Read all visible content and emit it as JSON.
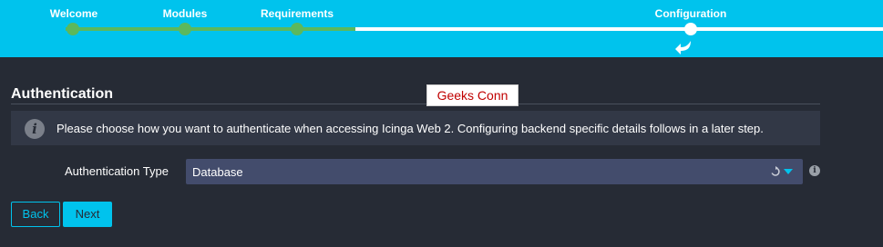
{
  "wizard": {
    "steps": [
      {
        "label": "Welcome",
        "state": "done"
      },
      {
        "label": "Modules",
        "state": "done"
      },
      {
        "label": "Requirements",
        "state": "done"
      },
      {
        "label": "Configuration",
        "state": "current"
      }
    ],
    "back_icon": "return-arrow-icon",
    "colors": {
      "header": "#00c3ed",
      "done": "#5cb85c",
      "todo": "#ffffff"
    }
  },
  "section": {
    "title": "Authentication",
    "info_icon": "info-icon",
    "info_text": "Please choose how you want to authenticate when accessing Icinga Web 2. Configuring backend specific details follows in a later step."
  },
  "watermark": {
    "text": "Geeks Conn"
  },
  "form": {
    "auth_type": {
      "label": "Authentication Type",
      "value": "Database",
      "refresh_icon": "refresh-icon",
      "dropdown_icon": "chevron-down-icon",
      "help_icon": "help-icon"
    }
  },
  "buttons": {
    "back": "Back",
    "next": "Next"
  }
}
